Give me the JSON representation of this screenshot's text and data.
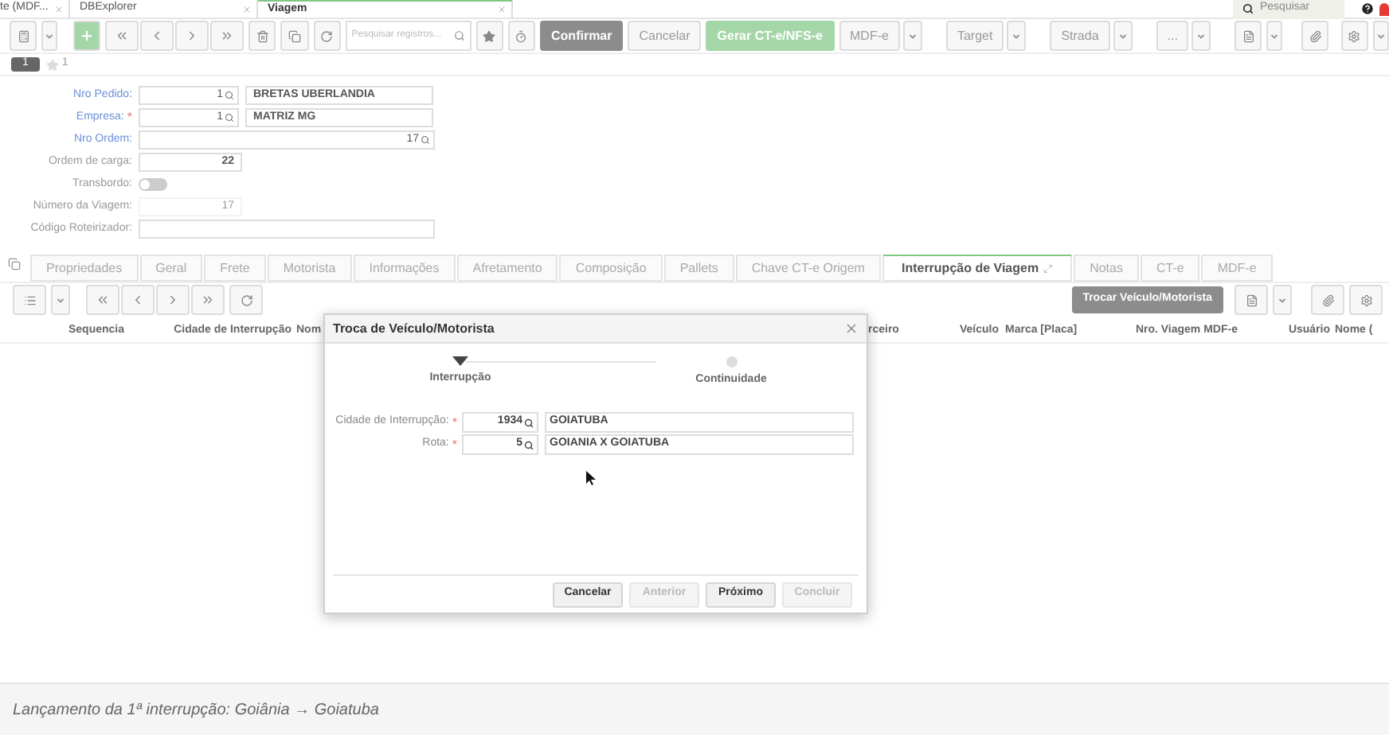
{
  "browser_tabs": [
    {
      "label": "te (MDF...",
      "selected": false
    },
    {
      "label": "DBExplorer",
      "selected": false
    },
    {
      "label": "Viagem",
      "selected": true
    }
  ],
  "global_search": {
    "placeholder": "Pesquisar"
  },
  "toolbar": {
    "search": {
      "placeholder": "Pesquisar registros..."
    },
    "buttons": [
      {
        "label": "Confirmar",
        "kind": "primary"
      },
      {
        "label": "Cancelar",
        "kind": "plain"
      },
      {
        "label": "Gerar CT-e/NFS-e",
        "kind": "success"
      },
      {
        "label": "MDF-e",
        "kind": "dropdown"
      },
      {
        "label": "Target",
        "kind": "dropdown"
      },
      {
        "label": "Strada",
        "kind": "dropdown"
      },
      {
        "label": "...",
        "kind": "dropdown"
      }
    ]
  },
  "record_bar": {
    "index": "1",
    "favorites": "1"
  },
  "form": {
    "fields": [
      {
        "label": "Nro Pedido:",
        "kind": "lookup",
        "linked": true,
        "code": "1",
        "description": "BRETAS UBERLANDIA"
      },
      {
        "label": "Empresa:",
        "kind": "lookup",
        "linked": true,
        "required_mark": "*",
        "code": "1",
        "description": "MATRIZ MG"
      },
      {
        "label": "Nro Ordem:",
        "kind": "lookup_wide",
        "linked": true,
        "code": "17"
      },
      {
        "label": "Ordem de carga:",
        "kind": "number",
        "linked": false,
        "value": "22"
      },
      {
        "label": "Transbordo:",
        "kind": "toggle",
        "linked": false,
        "on": false
      },
      {
        "label": "Número da Viagem:",
        "kind": "readonly",
        "linked": false,
        "value": "17"
      },
      {
        "label": "Código Roteirizador:",
        "kind": "text",
        "linked": false
      }
    ]
  },
  "detail_tabs": [
    {
      "label": "Propriedades",
      "selected": false
    },
    {
      "label": "Geral",
      "selected": false
    },
    {
      "label": "Frete",
      "selected": false
    },
    {
      "label": "Motorista",
      "selected": false
    },
    {
      "label": "Informações",
      "selected": false
    },
    {
      "label": "Afretamento",
      "selected": false
    },
    {
      "label": "Composição",
      "selected": false
    },
    {
      "label": "Pallets",
      "selected": false
    },
    {
      "label": "Chave CT-e Origem",
      "selected": false
    },
    {
      "label": "Interrupção de Viagem",
      "selected": true
    },
    {
      "label": "Notas",
      "selected": false
    },
    {
      "label": "CT-e",
      "selected": false
    },
    {
      "label": "MDF-e",
      "selected": false
    }
  ],
  "detail_toolbar": {
    "action": "Trocar Veículo/Motorista"
  },
  "table": {
    "columns": [
      "Sequencia",
      "Cidade de Interrupção",
      "Nom",
      "rceiro",
      "Veículo",
      "Marca [Placa]",
      "Nro. Viagem MDF-e",
      "Usuário",
      "Nome ("
    ]
  },
  "dialog": {
    "title": "Troca de Veículo/Motorista",
    "steps": [
      {
        "label": "Interrupção",
        "selected": true
      },
      {
        "label": "Continuidade",
        "selected": false
      }
    ],
    "fields": [
      {
        "label": "Cidade de Interrupção:",
        "required_mark": "*",
        "code": "1934",
        "description": "GOIATUBA"
      },
      {
        "label": "Rota:",
        "required_mark": "*",
        "code": "5",
        "description": "GOIANIA X GOIATUBA"
      }
    ],
    "buttons": [
      {
        "label": "Cancelar",
        "disabled": false
      },
      {
        "label": "Anterior",
        "disabled": true
      },
      {
        "label": "Próximo",
        "disabled": false
      },
      {
        "label": "Concluir",
        "disabled": true
      }
    ]
  },
  "caption": "Lançamento da 1ª interrupção: Goiânia → Goiatuba"
}
